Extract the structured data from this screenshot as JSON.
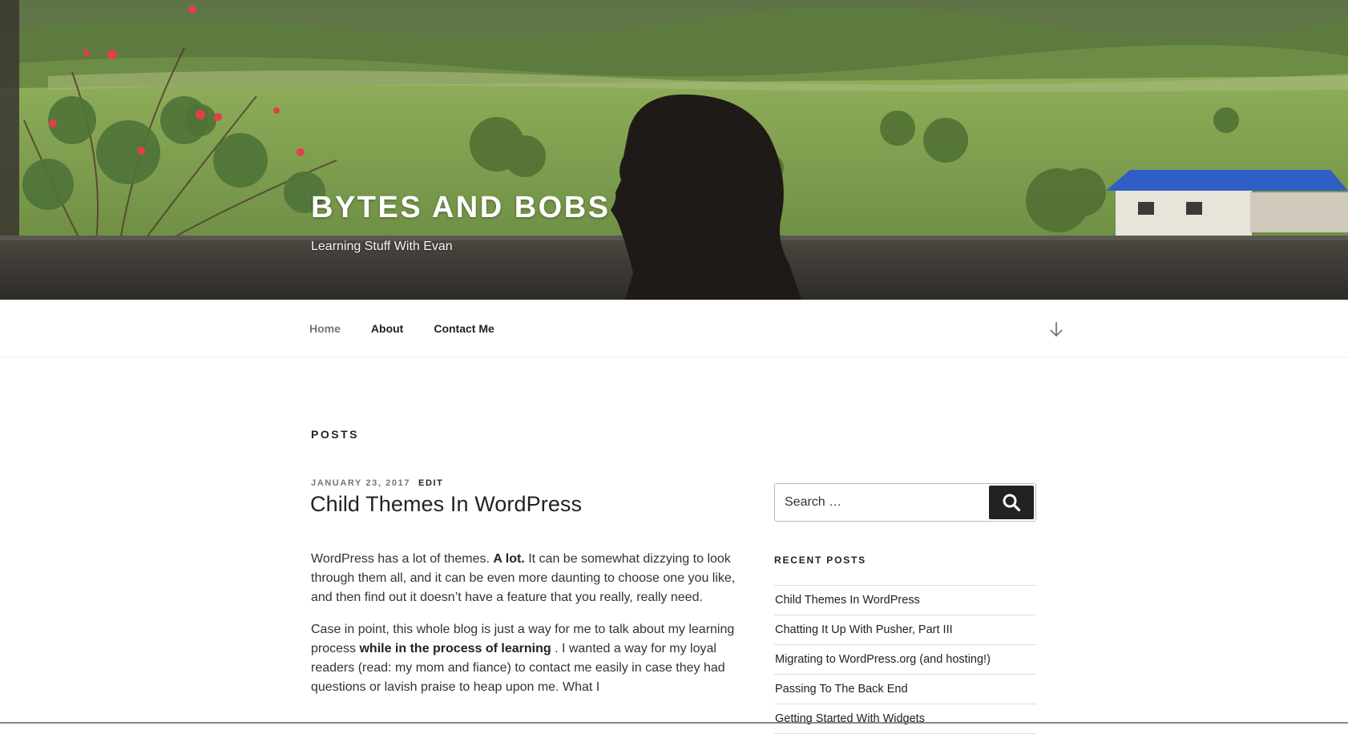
{
  "site": {
    "title": "Bytes and Bobs",
    "description": "Learning Stuff With Evan"
  },
  "nav": {
    "items": [
      {
        "label": "Home",
        "current": true
      },
      {
        "label": "About",
        "current": false
      },
      {
        "label": "Contact Me",
        "current": false
      }
    ],
    "scroll_icon": "arrow-down-icon"
  },
  "page_header": "Posts",
  "post": {
    "date": "January 23, 2017",
    "edit_label": "Edit",
    "title": "Child Themes In WordPress",
    "p1_a": "WordPress has a lot of themes. ",
    "p1_bold": "A lot.",
    "p1_b": " It can be somewhat dizzying to look through them all, and it can be even more daunting to choose one you like, and then find out it doesn’t have a feature that you really, really need.",
    "p2_a": "Case in point, this whole blog is just a way for me to talk about my learning process ",
    "p2_bold": "while in the process of learning",
    "p2_b": " . I wanted a way for my loyal readers (read: my mom and fiance) to contact me easily in case they had questions or lavish praise to heap upon me. What I"
  },
  "search": {
    "placeholder": "Search …",
    "icon": "search-icon"
  },
  "recent_posts": {
    "title": "Recent Posts",
    "items": [
      "Child Themes In WordPress",
      "Chatting It Up With Pusher, Part III",
      "Migrating to WordPress.org (and hosting!)",
      "Passing To The Back End",
      "Getting Started With Widgets"
    ]
  },
  "colors": {
    "text": "#222222",
    "muted": "#767676",
    "search_button": "#222222",
    "roof_blue": "#2f5fc4"
  }
}
